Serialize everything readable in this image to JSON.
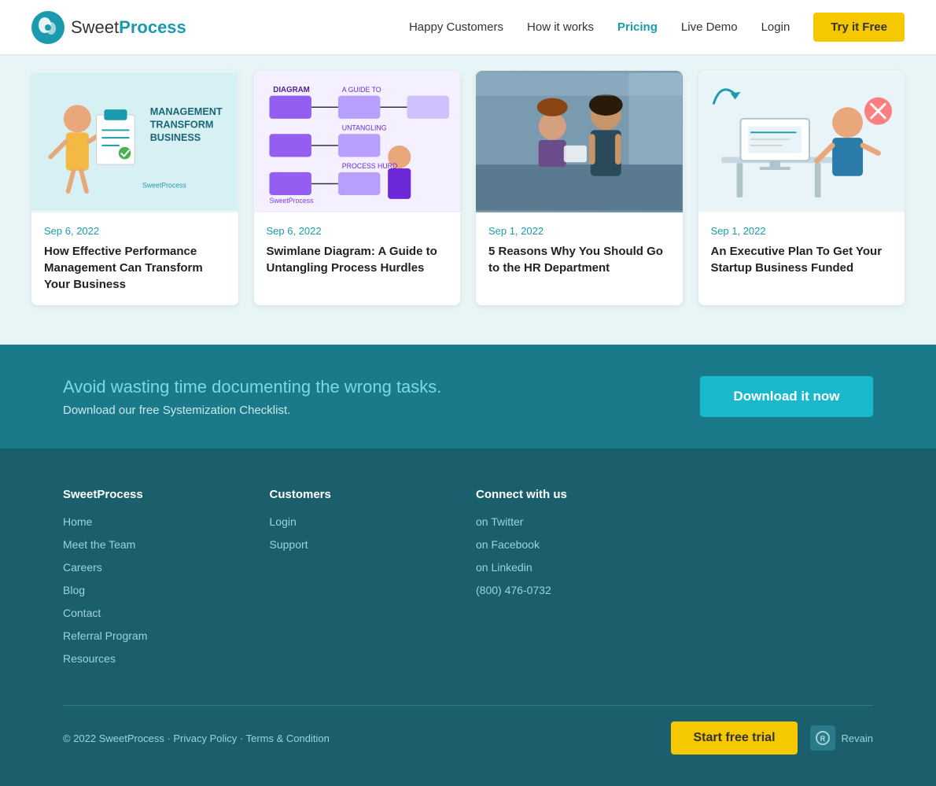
{
  "header": {
    "logo_text_light": "Sweet",
    "logo_text_bold": "Process",
    "nav": [
      {
        "id": "happy-customers",
        "label": "Happy Customers",
        "active": false
      },
      {
        "id": "how-it-works",
        "label": "How it works",
        "active": false
      },
      {
        "id": "pricing",
        "label": "Pricing",
        "active": true
      },
      {
        "id": "live-demo",
        "label": "Live Demo",
        "active": false
      },
      {
        "id": "login",
        "label": "Login",
        "active": false
      }
    ],
    "cta_label": "Try it Free"
  },
  "cards": [
    {
      "id": "card-1",
      "date": "Sep 6, 2022",
      "title": "How Effective Performance Management Can Transform Your Business",
      "image_label": "MANAGEMENT TRANSFORM BUSINESS",
      "image_type": "illustration-teal"
    },
    {
      "id": "card-2",
      "date": "Sep 6, 2022",
      "title": "Swimlane Diagram: A Guide to Untangling Process Hurdles",
      "image_label": "DIAGRAM A GUIDE TO UNTANGLING PROCESS HURDLES",
      "image_type": "illustration-purple"
    },
    {
      "id": "card-3",
      "date": "Sep 1, 2022",
      "title": "5 Reasons Why You Should Go to the HR Department",
      "image_label": "Photo of two business women",
      "image_type": "photo"
    },
    {
      "id": "card-4",
      "date": "Sep 1, 2022",
      "title": "An Executive Plan To Get Your Startup Business Funded",
      "image_label": "Illustration of person at desk",
      "image_type": "illustration-light"
    }
  ],
  "cta_banner": {
    "heading": "Avoid wasting time documenting the wrong tasks.",
    "subtext": "Download our free Systemization Checklist.",
    "button_label": "Download it now"
  },
  "footer": {
    "brand_col": {
      "heading": "SweetProcess",
      "links": [
        {
          "label": "Home",
          "href": "#"
        },
        {
          "label": "Meet the Team",
          "href": "#"
        },
        {
          "label": "Careers",
          "href": "#"
        },
        {
          "label": "Blog",
          "href": "#"
        },
        {
          "label": "Contact",
          "href": "#"
        },
        {
          "label": "Referral Program",
          "href": "#"
        },
        {
          "label": "Resources",
          "href": "#"
        }
      ]
    },
    "customers_col": {
      "heading": "Customers",
      "links": [
        {
          "label": "Login",
          "href": "#"
        },
        {
          "label": "Support",
          "href": "#"
        }
      ]
    },
    "connect_col": {
      "heading": "Connect with us",
      "links": [
        {
          "label": "on Twitter",
          "href": "#"
        },
        {
          "label": "on Facebook",
          "href": "#"
        },
        {
          "label": "on Linkedin",
          "href": "#"
        },
        {
          "label": "(800) 476-0732",
          "href": "#"
        }
      ]
    },
    "copyright": "© 2022 SweetProcess · Privacy Policy · Terms & Condition",
    "start_free_label": "Start free trial",
    "revain_label": "Revain"
  }
}
